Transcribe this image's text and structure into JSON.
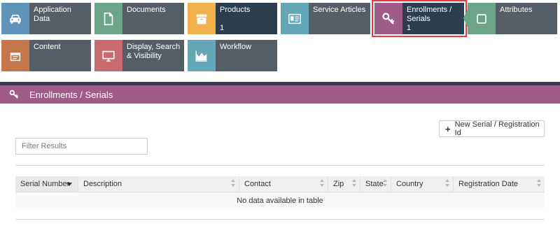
{
  "tiles": [
    {
      "label": "Application Data",
      "count": "",
      "icon": "car-icon",
      "color": "#5f93ba"
    },
    {
      "label": "Documents",
      "count": "",
      "icon": "document-icon",
      "color": "#6aa58a"
    },
    {
      "label": "Products",
      "count": "1",
      "icon": "box-icon",
      "color": "#f1b24e"
    },
    {
      "label": "Service Articles",
      "count": "",
      "icon": "id-card-icon",
      "color": "#63a7b9"
    },
    {
      "label": "Enrollments / Serials",
      "count": "1",
      "icon": "key-icon",
      "color": "#a05b87"
    },
    {
      "label": "Attributes",
      "count": "",
      "icon": "square-icon",
      "color": "#6aa58a"
    },
    {
      "label": "Content",
      "count": "",
      "icon": "content-icon",
      "color": "#c3774b"
    },
    {
      "label": "Display, Search & Visibility",
      "count": "",
      "icon": "monitor-icon",
      "color": "#c96a6e"
    },
    {
      "label": "Workflow",
      "count": "",
      "icon": "chart-icon",
      "color": "#63a7b9"
    }
  ],
  "section": {
    "title": "Enrollments / Serials",
    "color": "#a05b87"
  },
  "toolbar": {
    "new_label": "New Serial / Registration Id"
  },
  "filter": {
    "placeholder": "Filter Results",
    "value": ""
  },
  "table": {
    "columns": [
      {
        "label": "Serial Number",
        "sort": "desc"
      },
      {
        "label": "Description",
        "sort": "both"
      },
      {
        "label": "Contact",
        "sort": "both"
      },
      {
        "label": "Zip",
        "sort": "both"
      },
      {
        "label": "State",
        "sort": "both"
      },
      {
        "label": "Country",
        "sort": "both"
      },
      {
        "label": "Registration Date",
        "sort": "both"
      }
    ],
    "empty_message": "No data available in table"
  },
  "colors": {
    "accent": "#a05b87",
    "dark": "#2d3f4f",
    "active_outline": "#e8393e"
  }
}
